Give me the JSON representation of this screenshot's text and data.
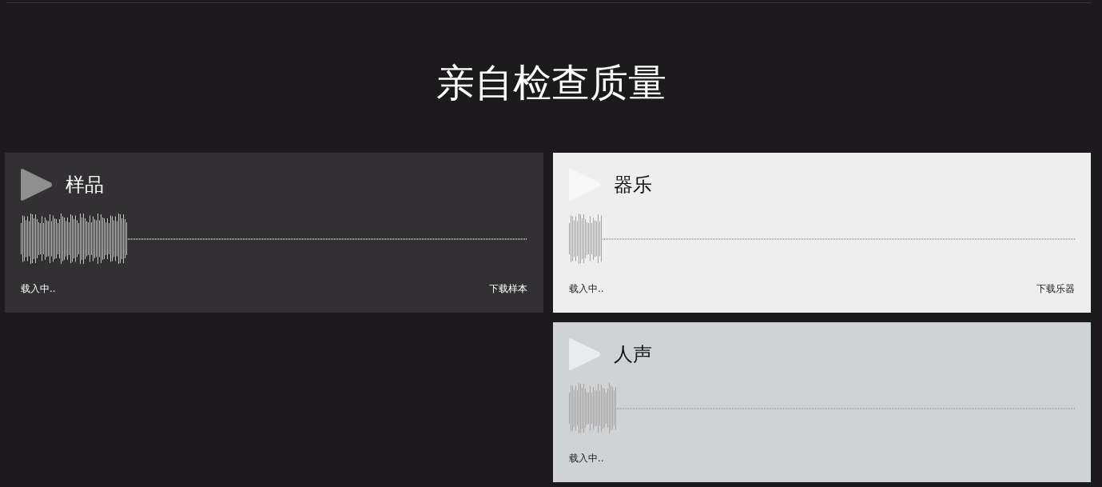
{
  "heading": "亲自检查质量",
  "columns": [
    {
      "cards": [
        {
          "title": "样品",
          "color": "#323033",
          "waveform": {
            "level": 0.21
          },
          "status": "载入中..",
          "download": "下载样本"
        }
      ]
    },
    {
      "cards": [
        {
          "title": "器乐",
          "color": "#eeeeee",
          "waveform": {
            "level": 0.065
          },
          "status": "载入中..",
          "download": "下载乐器"
        },
        {
          "title": "人声",
          "color": "#d0d3d6",
          "waveform": {
            "level": 0.093
          },
          "status": "载入中.."
        }
      ]
    }
  ]
}
